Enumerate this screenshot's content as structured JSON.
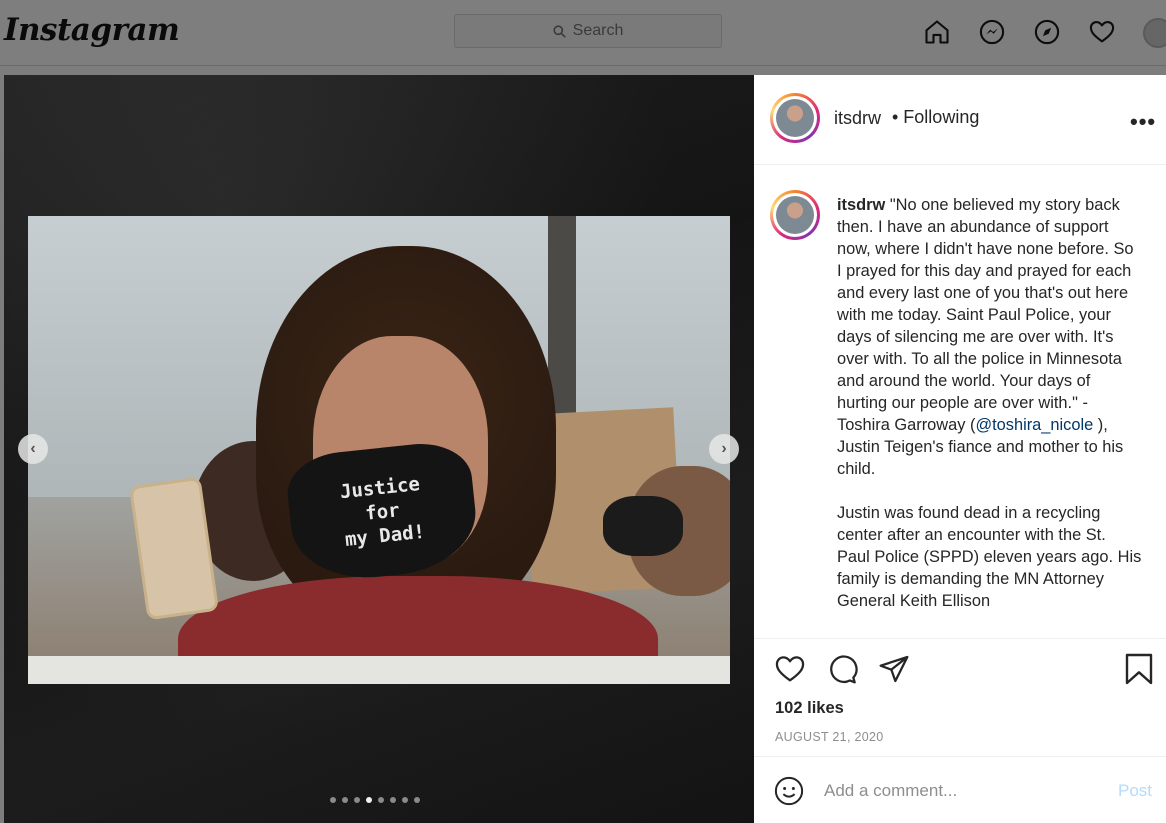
{
  "topbar": {
    "logo": "Instagram",
    "search_placeholder": "Search",
    "icons": [
      "home-icon",
      "messenger-icon",
      "explore-icon",
      "heart-icon",
      "profile-avatar"
    ]
  },
  "media": {
    "mask_text": "Justice\nfor\nmy Dad!",
    "carousel_total": 8,
    "carousel_active_index": 3,
    "prev_icon": "chevron-left-icon",
    "next_icon": "chevron-right-icon"
  },
  "header": {
    "username": "itsdrw",
    "follow_status": "• Following",
    "more_icon": "more-options-icon"
  },
  "caption": {
    "username": "itsdrw",
    "text_before_mention": "\"No one believed my story back then. I have an abundance of support now, where I didn't have none before. So I prayed for this day and prayed for each and every last one of you that's out here with me today. Saint Paul Police, your days of silencing me are over with. It's over with. To all the police in Minnesota and around the world. Your days of hurting our people are over with.\" - Toshira Garroway (",
    "mention": "@toshira_nicole",
    "text_after_mention": " ), Justin Teigen's fiance and mother to his child.",
    "paragraph2": "Justin was found dead in a recycling center after an encounter with the St. Paul Police (SPPD) eleven years ago. His family is demanding the MN Attorney General Keith Ellison"
  },
  "actions": {
    "likes": "102 likes",
    "date": "AUGUST 21, 2020"
  },
  "comment": {
    "placeholder": "Add a comment...",
    "post_label": "Post"
  },
  "colors": {
    "accent_link": "#00376b",
    "post_disabled": "#b3dbff",
    "meta_gray": "#8e8e8e"
  }
}
